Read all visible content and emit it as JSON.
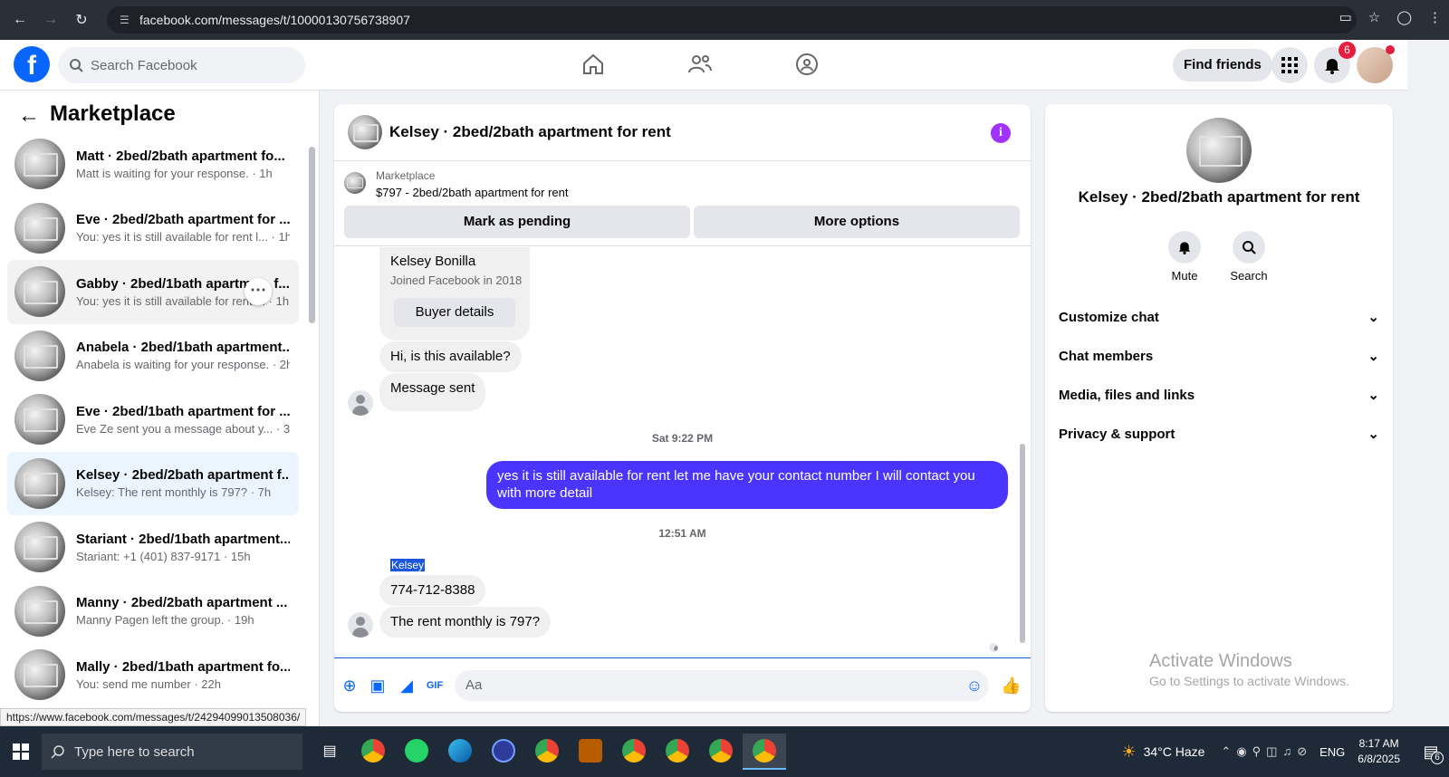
{
  "browser": {
    "url": "facebook.com/messages/t/10000130756738907",
    "status_url": "https://www.facebook.com/messages/t/24294099013508036/"
  },
  "topbar": {
    "search_placeholder": "Search Facebook",
    "find_friends": "Find friends",
    "notifications_count": "6"
  },
  "sidebar": {
    "title": "Marketplace",
    "conversations": [
      {
        "name": "Matt · 2bed/2bath apartment fo...",
        "sub": "Matt is waiting for your response. · 1h"
      },
      {
        "name": "Eve · 2bed/2bath apartment for ...",
        "sub": "You: yes it is still available for rent l... · 1h"
      },
      {
        "name": "Gabby · 2bed/1bath apartme... f...",
        "sub": "You: yes it is still available for rent ... · 1h"
      },
      {
        "name": "Anabela · 2bed/1bath apartment...",
        "sub": "Anabela is waiting for your response. · 2h"
      },
      {
        "name": "Eve · 2bed/1bath apartment for ...",
        "sub": "Eve Ze sent you a message about y... · 3h"
      },
      {
        "name": "Kelsey · 2bed/2bath apartment f...",
        "sub": "Kelsey: The rent monthly is 797? · 7h"
      },
      {
        "name": "Stariant · 2bed/1bath apartment...",
        "sub": "Stariant: +1 (401) 837-9171 · 15h"
      },
      {
        "name": "Manny · 2bed/2bath apartment ...",
        "sub": "Manny Pagen left the group. · 19h"
      },
      {
        "name": "Mally · 2bed/1bath apartment fo...",
        "sub": "You: send me number · 22h"
      }
    ]
  },
  "chat": {
    "title": "Kelsey · 2bed/2bath apartment for rent",
    "marketplace_label": "Marketplace",
    "listing": "$797 - 2bed/2bath apartment for rent",
    "mark_pending": "Mark as pending",
    "more_options": "More options",
    "profile_name": "Kelsey Bonilla",
    "profile_joined": "Joined Facebook in 2018",
    "buyer_details": "Buyer details",
    "msg1": "Hi, is this available?",
    "msg2": "Message sent",
    "ts1": "Sat 9:22 PM",
    "mine": "yes it is still available for rent let me have your contact number I will contact you with more detail",
    "ts2": "12:51 AM",
    "sender": "Kelsey",
    "msg3": "774-712-8388",
    "msg4": "The rent monthly is 797?",
    "composer_placeholder": "Aa"
  },
  "details": {
    "title": "Kelsey · 2bed/2bath apartment for rent",
    "mute": "Mute",
    "search": "Search",
    "sections": [
      "Customize chat",
      "Chat members",
      "Media, files and links",
      "Privacy & support"
    ]
  },
  "watermark": {
    "line1": "Activate Windows",
    "line2": "Go to Settings to activate Windows."
  },
  "taskbar": {
    "search": "Type here to search",
    "weather": "34°C  Haze",
    "lang": "ENG",
    "time": "8:17 AM",
    "date": "6/8/2025",
    "notif": "6"
  }
}
